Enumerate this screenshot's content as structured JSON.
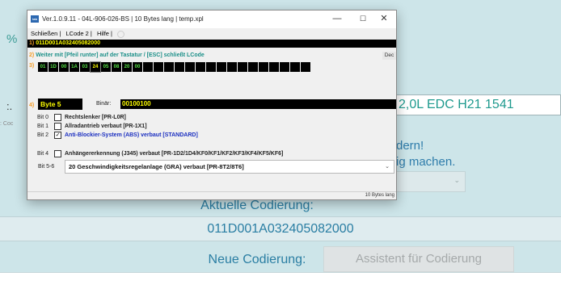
{
  "background": {
    "percent_glyph": "%",
    "ecu_field": "2,0L EDC  H21 1541",
    "left_colon": ":.",
    "left_small": ": Coc",
    "warning_line1": "dern!",
    "warning_line2": "ig machen.",
    "aktuelle_label": "Aktuelle Codierung:",
    "current_code": "011D001A032405082000",
    "neue_label": "Neue Codierung:",
    "assistent_button": "Assistent für Codierung"
  },
  "window": {
    "title": "Ver.1.0.9.11 -  04L-906-026-BS | 10 Bytes lang | temp.xpl",
    "icon_text": "lab",
    "minimize": "—",
    "maximize": "☐",
    "close": "✕",
    "menu": [
      "Schließen |",
      "LCode 2 |",
      "Hilfe |"
    ],
    "row1_num": "1)",
    "code_value": "011D001A032405082000",
    "row2_num": "2)",
    "instruction": "Weiter mit [Pfeil runter] auf der Tastatur / [ESC] schließt LCode",
    "dec_label": "Dec",
    "row3_num": "3)",
    "bytes": [
      "01",
      "1D",
      "00",
      "1A",
      "03",
      "24",
      "05",
      "08",
      "20",
      "00",
      "",
      "",
      "",
      "",
      "",
      "",
      "",
      "",
      "",
      "",
      "",
      "",
      "",
      "",
      "",
      ""
    ],
    "selected_byte_index": 5,
    "row4_num": "4)",
    "byte_label": "Byte 5",
    "binar_label": "Binär:",
    "binar_value": "00100100",
    "bits": [
      {
        "id": "Bit 0",
        "checked": false,
        "check_glyph": "",
        "label": "Rechtslenker [PR-L0R]",
        "color": "normal"
      },
      {
        "id": "Bit 1",
        "checked": false,
        "check_glyph": "",
        "label": "Allradantrieb verbaut [PR-1X1]",
        "color": "normal"
      },
      {
        "id": "Bit 2",
        "checked": true,
        "check_glyph": "✓",
        "label": "Anti-Blockier-System (ABS) verbaut [STANDARD]",
        "color": "blue"
      },
      {
        "id": "Bit 4",
        "checked": false,
        "check_glyph": "",
        "label": "Anhängererkennung (J345) verbaut [PR-1D2/1D4/KF0/KF1/KF2/KF3/KF4/KF5/KF6]",
        "color": "normal"
      }
    ],
    "bit56_label": "Bit 5-6",
    "bit56_value": "20 Geschwindigkeitsregelanlage (GRA) verbaut [PR-8T2/8T6]",
    "status_text": "10 Bytes lang"
  }
}
